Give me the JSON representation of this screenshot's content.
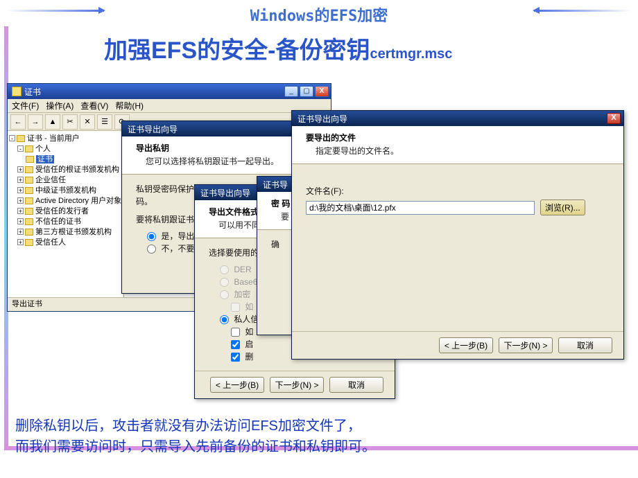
{
  "header": {
    "top_title": "Windows的EFS加密",
    "main_prefix": "加强",
    "main_efs": "EFS",
    "main_mid": "的安全",
    "main_dash": "-",
    "main_backup": "备份密钥",
    "main_suffix": "certmgr.msc"
  },
  "mmc": {
    "title": "证书",
    "menus": {
      "file": "文件(F)",
      "action": "操作(A)",
      "view": "查看(V)",
      "help": "帮助(H)"
    },
    "tree": {
      "root": "证书 - 当前用户",
      "items": [
        "个人",
        "证书",
        "受信任的根证书颁发机构",
        "企业信任",
        "中级证书颁发机构",
        "Active Directory 用户对象",
        "受信任的发行者",
        "不信任的证书",
        "第三方根证书颁发机构",
        "受信任人"
      ]
    },
    "status": "导出证书"
  },
  "wizard1": {
    "title": "证书导出向导",
    "h1": "导出私钥",
    "h2": "您可以选择将私钥跟证书一起导出。",
    "body1": "私钥受密码保护",
    "body2": "码。",
    "body3": "要将私钥跟证书",
    "opt_yes": "是，导出",
    "opt_no": "不，不要"
  },
  "wizard2": {
    "title": "证书导出向导",
    "h1": "导出文件格式",
    "h2": "可以用不同",
    "body1": "选择要使用的",
    "opt_der": "DER",
    "opt_base": "Base6",
    "opt_enc": "加密",
    "chk1": "如",
    "opt_priv": "私人信",
    "chk2": "如",
    "chk3": "启",
    "chk4": "删"
  },
  "wizard3": {
    "title": "证书导",
    "h1": "密 码",
    "h2": "要",
    "body1": "确"
  },
  "wizard4": {
    "title": "证书导出向导",
    "h1": "要导出的文件",
    "h2": "指定要导出的文件名。",
    "file_label": "文件名(F):",
    "file_value": "d:\\我的文档\\桌面\\12.pfx",
    "browse": "浏览(R)...",
    "back": "< 上一步(B)",
    "next": "下一步(N) >",
    "cancel": "取消"
  },
  "caption": {
    "line1": "删除私钥以后，攻击者就没有办法访问EFS加密文件了，",
    "line2": "而我们需要访问时，只需导入先前备份的证书和私钥即可。"
  }
}
